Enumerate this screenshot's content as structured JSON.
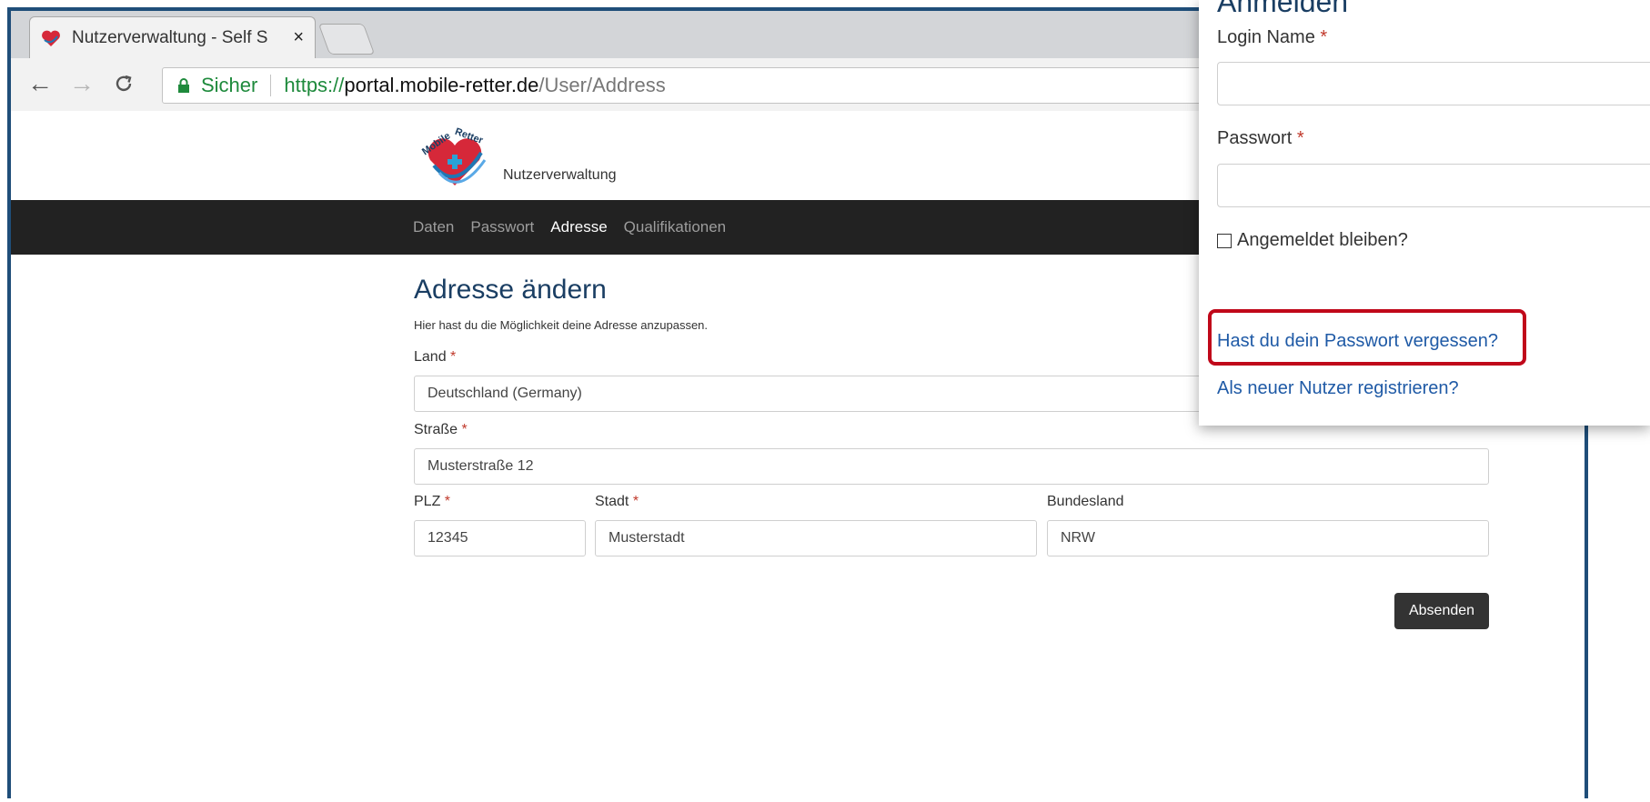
{
  "browser": {
    "tab_title": "Nutzerverwaltung - Self S",
    "tab_close": "×",
    "secure_label": "Sicher",
    "url_scheme": "https://",
    "url_host": "portal.mobile-retter.de",
    "url_path": "/User/Address"
  },
  "header": {
    "logo_alt": "Mobile Retter logo",
    "app_name": "Nutzerverwaltung"
  },
  "nav": {
    "items": [
      {
        "label": "Daten",
        "active": false
      },
      {
        "label": "Passwort",
        "active": false
      },
      {
        "label": "Adresse",
        "active": true
      },
      {
        "label": "Qualifikationen",
        "active": false
      }
    ]
  },
  "form": {
    "title": "Adresse ändern",
    "intro": "Hier hast du die Möglichkeit deine Adresse anzupassen.",
    "required_mark": "*",
    "land_label": "Land",
    "land_value": "Deutschland (Germany)",
    "strasse_label": "Straße",
    "strasse_value": "Musterstraße 12",
    "plz_label": "PLZ",
    "plz_value": "12345",
    "stadt_label": "Stadt",
    "stadt_value": "Musterstadt",
    "bundesland_label": "Bundesland",
    "bundesland_value": "NRW",
    "submit_label": "Absenden"
  },
  "login": {
    "title": "Anmelden",
    "login_name_label": "Login Name",
    "password_label": "Passwort",
    "remember_label": "Angemeldet bleiben?",
    "forgot_link": "Hast du dein Passwort vergessen?",
    "register_link": "Als neuer Nutzer registrieren?"
  },
  "colors": {
    "navbar_bg": "#222222",
    "heading": "#1a3e63",
    "link": "#1f5aa6",
    "highlight": "#c0081a",
    "secure": "#1e8a3c"
  }
}
